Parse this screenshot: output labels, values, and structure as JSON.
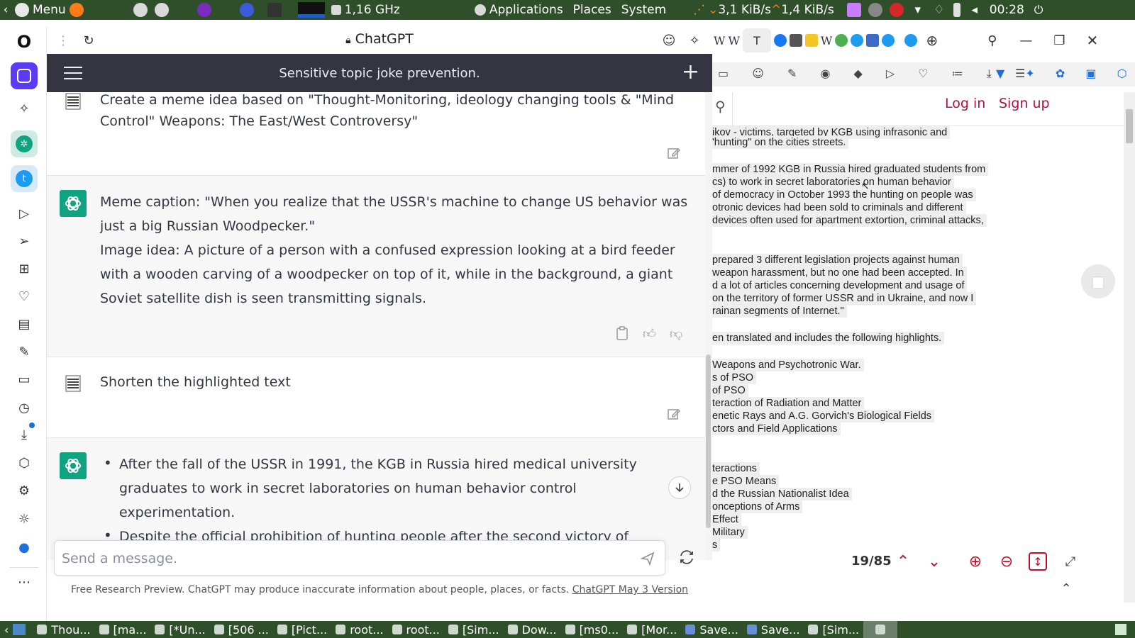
{
  "system_panel": {
    "menu_label": "Menu",
    "cpu_freq": "1,16 GHz",
    "applications": "Applications",
    "places": "Places",
    "system": "System",
    "net_down": "3,1 KiB/s",
    "net_up": "1,4 KiB/s",
    "clock": "00:28"
  },
  "opera_sidebar": {
    "items": [
      "opera-logo-icon",
      "workspace-icon",
      "aria-icon",
      "chatgpt-icon",
      "twitter-icon",
      "player-icon",
      "send-icon",
      "apps-icon",
      "heart-icon",
      "news-icon",
      "pinboard-icon",
      "tabs-icon",
      "history-icon",
      "downloads-icon",
      "box-icon",
      "settings-icon",
      "bulb-icon",
      "messenger-icon",
      "more-icon"
    ]
  },
  "chat_panel": {
    "site_title": "ChatGPT",
    "conversation_title": "Sensitive topic joke prevention.",
    "messages": [
      {
        "role": "user",
        "text": "Create a meme idea based on \"Thought-Monitoring, ideology changing tools & \"Mind Control\" Weapons: The East/West Controversy\""
      },
      {
        "role": "assistant",
        "paragraphs": [
          "Meme caption: \"When you realize that the USSR's machine to change US behavior was just a big Russian Woodpecker.\"",
          "Image idea: A picture of a person with a confused expression looking at a bird feeder with a wooden carving of a woodpecker on top of it, while in the background, a giant Soviet satellite dish is seen transmitting signals."
        ]
      },
      {
        "role": "user",
        "text": "Shorten the highlighted text"
      },
      {
        "role": "assistant",
        "bullets": [
          "After the fall of the USSR in 1991, the KGB in Russia hired medical university graduates to work in secret laboratories on human behavior control experimentation.",
          "Despite the official prohibition of hunting people after the second victory of democracy in"
        ]
      }
    ],
    "composer": {
      "placeholder": "Send a message."
    },
    "footer": {
      "note": "Free Research Preview. ChatGPT may produce inaccurate information about people, places, or facts.",
      "version_link": "ChatGPT May 3 Version"
    }
  },
  "right_page": {
    "login": "Log in",
    "signup": "Sign up",
    "doc_lines": [
      "ikov - victims, targeted by KGB using infrasonic and",
      "'hunting\" on the cities streets.",
      "mmer of 1992 KGB in Russia hired graduated students from",
      "cs) to work in secret laboratories on human behavior",
      " of democracy in October 1993 the hunting on people was",
      "otronic devices had been sold to criminals and different",
      " devices often used for apartment extortion, criminal attacks,",
      "prepared 3 different legislation projects against human",
      "weapon harassment, but no one had been accepted. In",
      "d a lot of articles concerning development and usage of",
      "on the territory of former USSR and in Ukraine, and now I",
      "rainan segments of Internet.\"",
      "en translated and includes the following highlights.",
      "Weapons and Psychotronic War.",
      "s of PSO",
      " of PSO",
      "teraction of Radiation and Matter",
      "enetic Rays and A.G. Gorvich's Biological Fields",
      "ctors and Field Applications",
      "teractions",
      "e PSO Means",
      "d the Russian Nationalist Idea",
      "onceptions of Arms",
      " Effect",
      "Military",
      "s"
    ],
    "page_indicator": "19/85"
  },
  "taskbar": {
    "tasks": [
      "Thou...",
      "[ma...",
      "[*Un...",
      "[506 ...",
      "[Pict...",
      "root...",
      "root...",
      "[Sim...",
      "Dow...",
      "[ms0...",
      "[Mor...",
      "Save...",
      "Save...",
      "[Sim..."
    ]
  }
}
